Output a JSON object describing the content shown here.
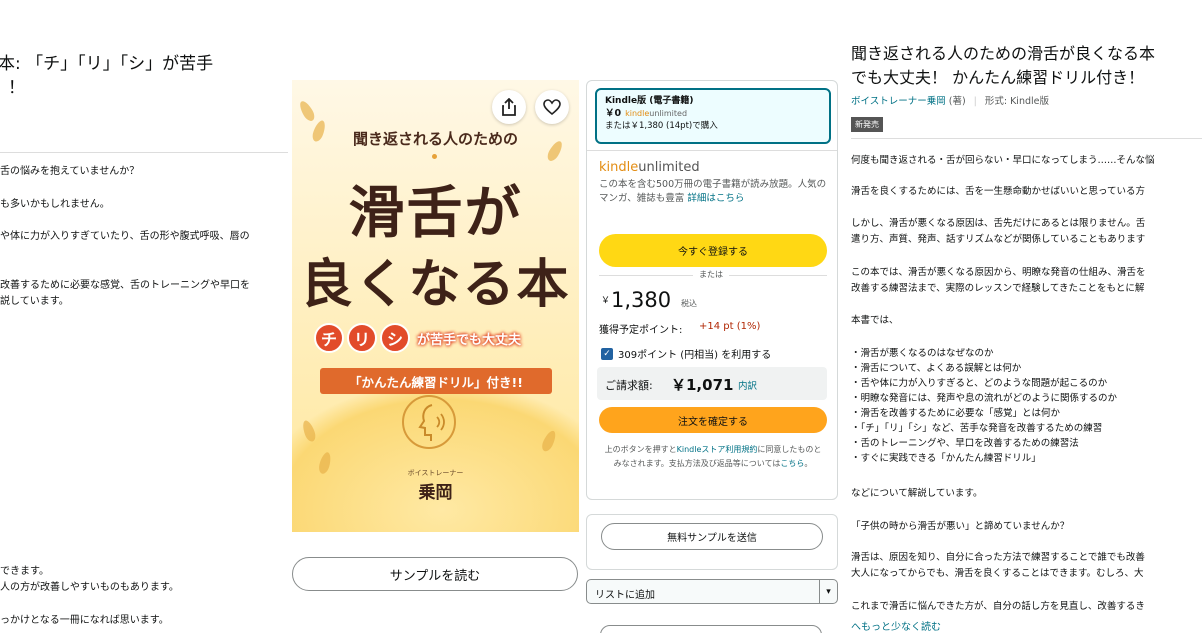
{
  "left_panel": {
    "title_line1": "本: 「チ」「リ」「シ」が苦手",
    "title_line2": "！",
    "lines": [
      "舌の悩みを抱えていませんか？",
      "も多いかもしれません。",
      "や体に力が入りすぎていたり、舌の形や腹式呼吸、唇の",
      "改善するために必要な感覚、舌のトレーニングや早口を",
      "説しています。",
      "できます。",
      "人の方が改善しやすいものもあります。",
      "っかけとなる一冊になれば思います。"
    ]
  },
  "cover": {
    "subtitle": "聞き返される人のための",
    "line1": "滑舌が",
    "line2": "良くなる本",
    "badges": [
      "チ",
      "リ",
      "シ"
    ],
    "badge_text": "が苦手でも大丈夫",
    "drill": "「かんたん練習ドリル」付き!!",
    "author_small": "ボイストレーナー",
    "author": "乗岡"
  },
  "sample_read_label": "サンプルを読む",
  "buybox": {
    "format_name": "Kindle版 (電子書籍)",
    "format_price": "￥0",
    "ku_small_brand": "kindle",
    "ku_small_rest": "unlimited",
    "format_alt": "または￥1,380 (14pt)で購入",
    "ku_logo_brand": "kindle",
    "ku_logo_rest": "unlimited",
    "ku_desc": "この本を含む500万冊の電子書籍が読み放題。人気のマンガ、雑誌も豊富",
    "ku_detail_link": "詳細はこちら",
    "subscribe_label": "今すぐ登録する",
    "or_label": "または",
    "price_yen": "￥",
    "price": "1,380",
    "tax_label": "税込",
    "points_label": "獲得予定ポイント:",
    "points_value": "+14 pt (1%)",
    "use_points_label": "309ポイント (円相当) を利用する",
    "bill_label": "ご請求額:",
    "bill_value": "￥1,071",
    "bill_detail": "内訳",
    "confirm_label": "注文を確定する",
    "legal_pre": "上のボタンを押すと",
    "legal_link": "Kindleストア利用規約",
    "legal_mid": "に同意したものとみなされます。支払方法及び返品等については",
    "legal_link2": "こちら",
    "legal_end": "。"
  },
  "send_sample_label": "無料サンプルを送信",
  "add_list_label": "リストに追加",
  "right": {
    "title_line1": "聞き返される人のための滑舌が良くなる本",
    "title_line2": "でも大丈夫！ かんたん練習ドリル付き！",
    "author_link": "ボイストレーナー乗岡",
    "author_role": " (著)",
    "format": "形式: Kindle版",
    "new_badge": "新発売",
    "lines": [
      "何度も聞き返される・舌が回らない・早口になってしまう……そんな悩",
      "滑舌を良くするためには、舌を一生懸命動かせばいいと思っている方",
      "しかし、滑舌が悪くなる原因は、舌先だけにあるとは限りません。舌",
      "遣り方、声質、発声、話すリズムなどが関係していることもあります",
      "この本では、滑舌が悪くなる原因から、明瞭な発音の仕組み、滑舌を",
      "改善する練習法まで、実際のレッスンで経験してきたことをもとに解",
      "本書では、",
      "・滑舌が悪くなるのはなぜなのか",
      "・滑舌について、よくある誤解とは何か",
      "・舌や体に力が入りすぎると、どのような問題が起こるのか",
      "・明瞭な発音には、発声や息の流れがどのように関係するのか",
      "・滑舌を改善するために必要な「感覚」とは何か",
      "・「チ」「リ」「シ」など、苦手な発音を改善するための練習",
      "・舌のトレーニングや、早口を改善するための練習法",
      "・すぐに実践できる「かんたん練習ドリル」",
      "などについて解説しています。",
      "「子供の時から滑舌が悪い」と諦めていませんか？",
      "滑舌は、原因を知り、自分に合った方法で練習することで誰でも改善",
      "大人になってからでも、滑舌を良くすることはできます。むしろ、大",
      "これまで滑舌に悩んできた方が、自分の話し方を見直し、改善するき"
    ],
    "show_less": "へもっと少なく読む"
  },
  "colors": {
    "link": "#007185",
    "subscribe": "#ffd814",
    "buy": "#ffa41c",
    "selected_border": "#007185"
  }
}
